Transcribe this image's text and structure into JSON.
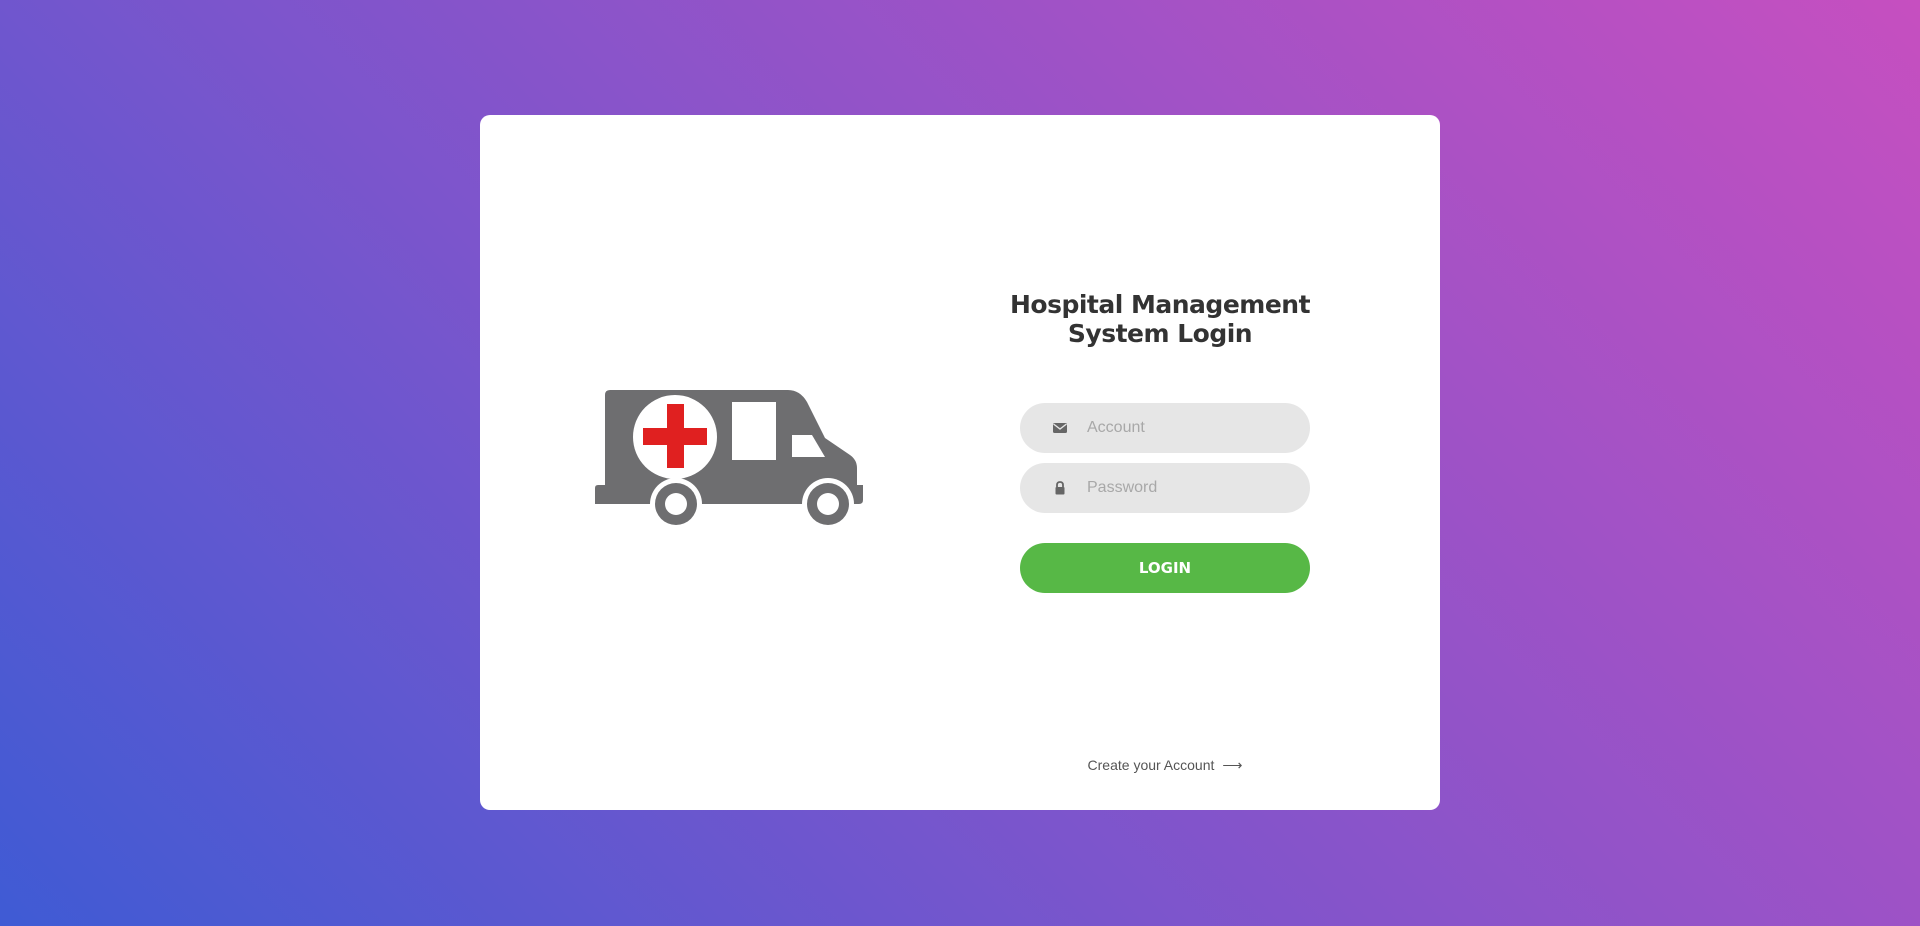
{
  "login": {
    "title_line1": "Hospital Management",
    "title_line2": "System Login",
    "account_placeholder": "Account",
    "account_value": "",
    "password_placeholder": "Password",
    "password_value": "",
    "login_label": "LOGIN",
    "create_account_label": "Create your Account",
    "create_account_arrow": "⟶"
  },
  "icons": {
    "illustration": "ambulance-icon",
    "account_field": "envelope-icon",
    "password_field": "lock-icon"
  },
  "colors": {
    "gradient_start": "#3f5bd4",
    "gradient_end": "#c64fc0",
    "card_background": "#ffffff",
    "field_background": "#e6e6e6",
    "login_button": "#57b846",
    "ambulance_body": "#6e6e70",
    "red_cross": "#e02020"
  }
}
